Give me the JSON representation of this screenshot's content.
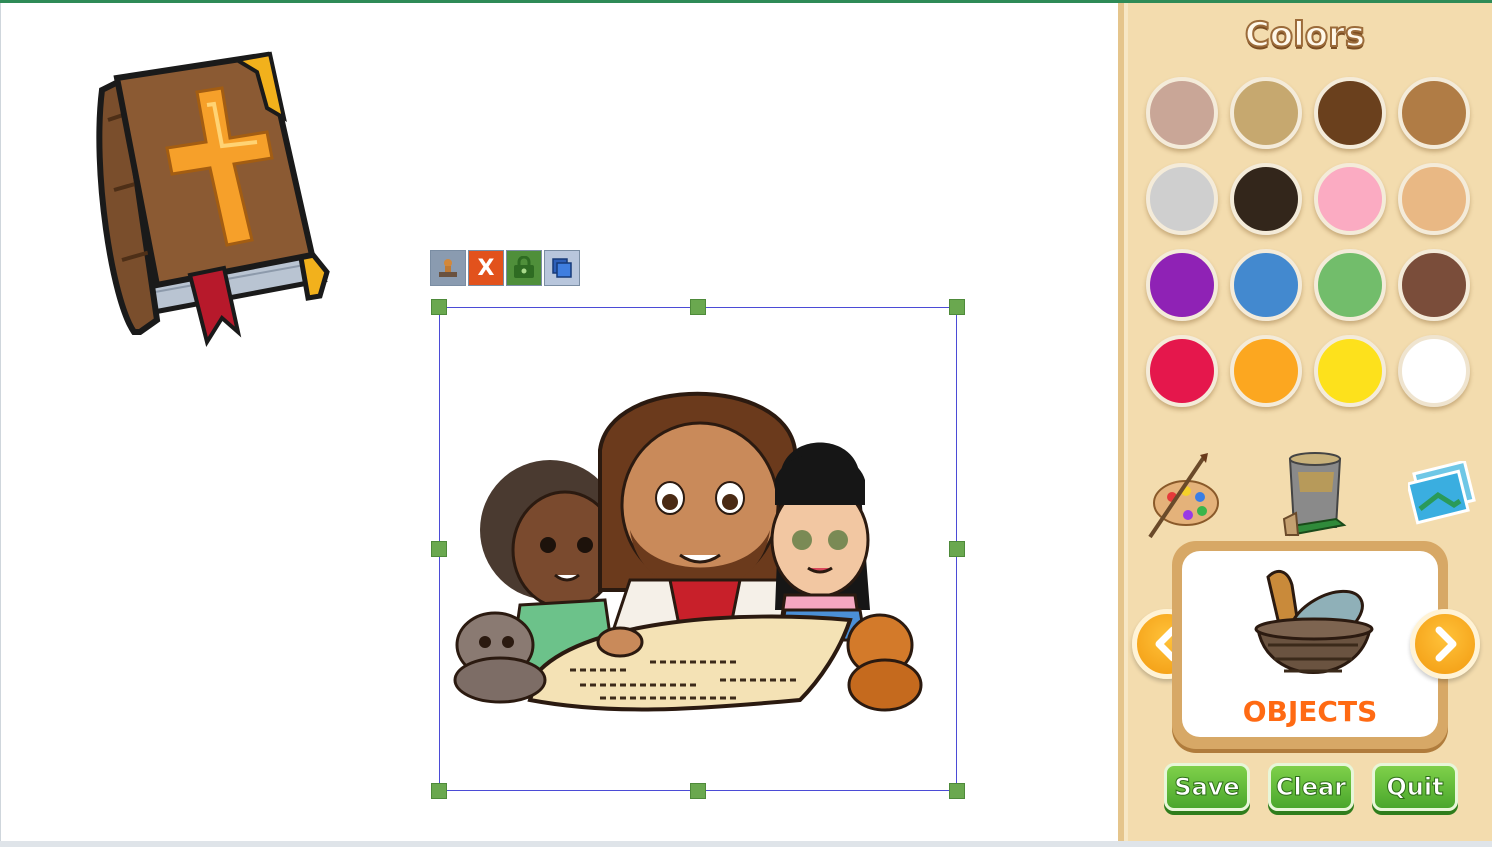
{
  "panel": {
    "title": "Colors",
    "swatches": [
      {
        "name": "swatch-rosy-beige",
        "color": "#c9a697"
      },
      {
        "name": "swatch-khaki",
        "color": "#c6a86f"
      },
      {
        "name": "swatch-dark-brown",
        "color": "#6a401d"
      },
      {
        "name": "swatch-light-brown",
        "color": "#b07c45"
      },
      {
        "name": "swatch-light-gray",
        "color": "#cfcfcf"
      },
      {
        "name": "swatch-black-brown",
        "color": "#33261b"
      },
      {
        "name": "swatch-pink",
        "color": "#fbabc2"
      },
      {
        "name": "swatch-peach",
        "color": "#e9b884"
      },
      {
        "name": "swatch-purple",
        "color": "#8f22b5"
      },
      {
        "name": "swatch-blue",
        "color": "#4389cf"
      },
      {
        "name": "swatch-green",
        "color": "#72bd6b"
      },
      {
        "name": "swatch-brown",
        "color": "#7a4d3a"
      },
      {
        "name": "swatch-crimson",
        "color": "#e5174c"
      },
      {
        "name": "swatch-orange",
        "color": "#fca720"
      },
      {
        "name": "swatch-yellow",
        "color": "#fde11c"
      },
      {
        "name": "swatch-white",
        "color": "#ffffff"
      }
    ],
    "category": {
      "label": "OBJECTS",
      "icon": "bread-fish-basket-icon"
    },
    "buttons": {
      "save": "Save",
      "clear": "Clear",
      "quit": "Quit"
    }
  },
  "selection_tools": {
    "delete_label": "X"
  },
  "stickers": {
    "bible": "bible-sticker",
    "scene": "jesus-children-scroll-sticker"
  }
}
